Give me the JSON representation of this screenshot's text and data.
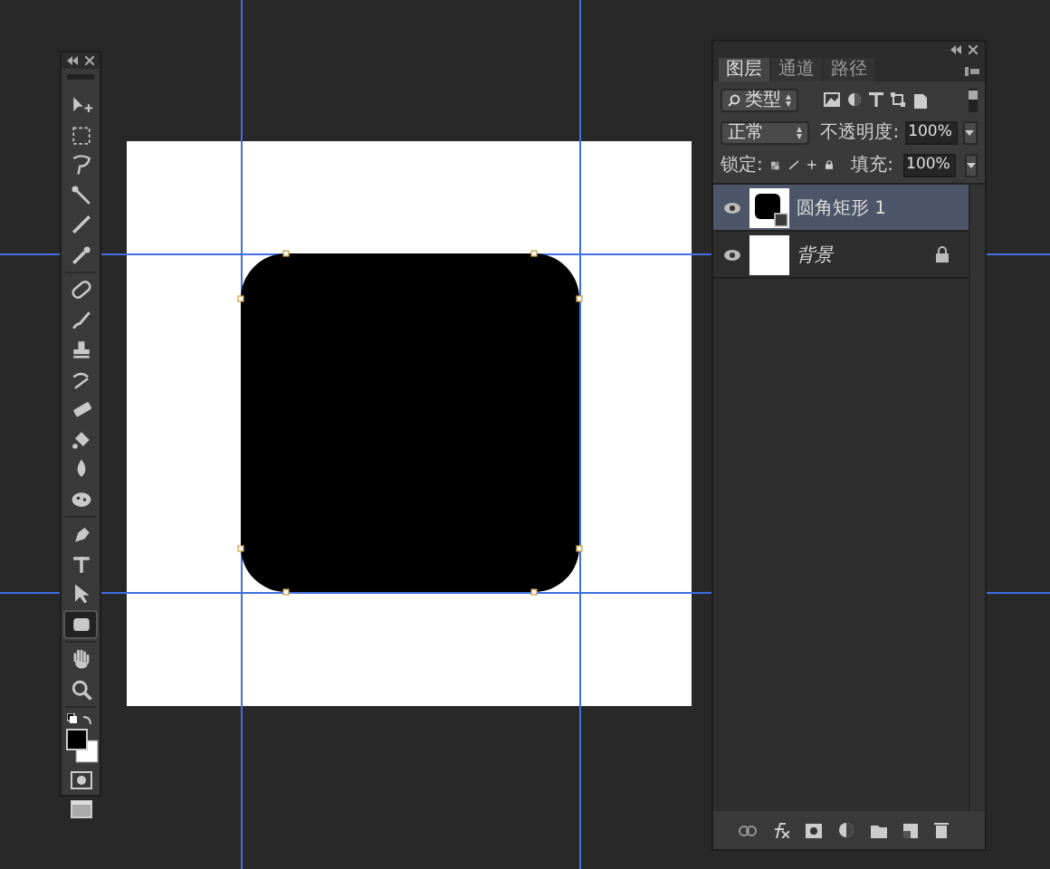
{
  "tools": [
    {
      "kind": "move",
      "selected": false
    },
    {
      "kind": "marquee",
      "selected": false
    },
    {
      "kind": "lasso",
      "selected": false
    },
    {
      "kind": "wand",
      "selected": false
    },
    {
      "kind": "crop",
      "selected": false
    },
    {
      "kind": "eyedropper",
      "selected": false
    },
    {
      "kind": "healing",
      "selected": false
    },
    {
      "kind": "brush",
      "selected": false
    },
    {
      "kind": "stamp",
      "selected": false
    },
    {
      "kind": "history",
      "selected": false
    },
    {
      "kind": "eraser",
      "selected": false
    },
    {
      "kind": "bucket",
      "selected": false
    },
    {
      "kind": "blur",
      "selected": false
    },
    {
      "kind": "dodge",
      "selected": false
    },
    {
      "kind": "pen",
      "selected": false
    },
    {
      "kind": "type",
      "selected": false
    },
    {
      "kind": "select",
      "selected": false
    },
    {
      "kind": "rectangle",
      "selected": true
    },
    {
      "kind": "hand",
      "selected": false
    },
    {
      "kind": "zoom",
      "selected": false
    }
  ],
  "layers_panel": {
    "tabs": [
      {
        "label": "图层",
        "selected": true
      },
      {
        "label": "通道",
        "selected": false
      },
      {
        "label": "路径",
        "selected": false
      }
    ],
    "filter": {
      "label": "类型",
      "on": true
    },
    "blend_mode": "正常",
    "opacity": {
      "label": "不透明度:",
      "value": "100%"
    },
    "lock": {
      "label": "锁定:"
    },
    "fill": {
      "label": "填充:",
      "value": "100%"
    },
    "layers": [
      {
        "kind": "shape",
        "name": "圆角矩形 1",
        "visible": true,
        "selected": true,
        "locked": false
      },
      {
        "kind": "background",
        "name": "背景",
        "visible": true,
        "selected": false,
        "locked": true
      }
    ]
  }
}
